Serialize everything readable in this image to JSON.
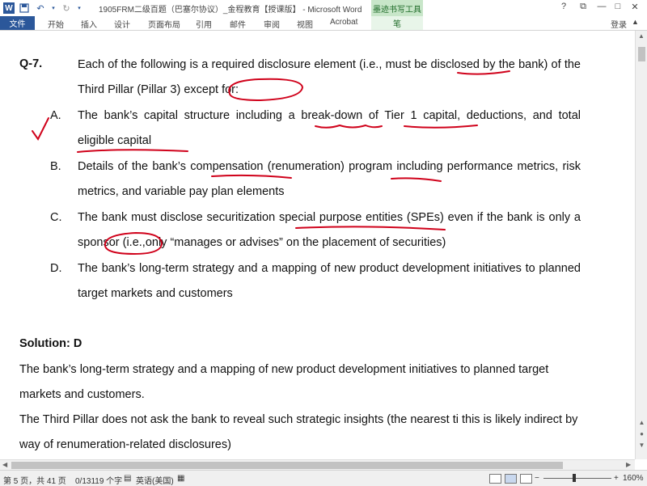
{
  "titlebar": {
    "title": "1905FRM二级百题（巴塞尔协议）_金程教育【授课版】 - Microsoft Word",
    "contextual_group": "墨迹书写工具",
    "help": "?",
    "restore": "⧉",
    "minimize": "—",
    "maximize": "□",
    "close": "✕"
  },
  "ribbon": {
    "file": "文件",
    "tabs": [
      "开始",
      "插入",
      "设计",
      "页面布局",
      "引用",
      "邮件",
      "审阅",
      "视图",
      "Acrobat"
    ],
    "contextual_tab": "笔",
    "login": "登录"
  },
  "document": {
    "question": {
      "label": "Q-7.",
      "stem": "Each of the following is a required disclosure element (i.e., must be disclosed by the bank) of the Third Pillar (Pillar 3) except for:"
    },
    "options": [
      {
        "letter": "A.",
        "text": "The bank’s capital structure including a break-down of Tier 1 capital, deductions, and total eligible capital"
      },
      {
        "letter": "B.",
        "text": "Details of the bank’s compensation (renumeration) program including performance metrics, risk metrics, and variable pay plan elements"
      },
      {
        "letter": "C.",
        "text": "The bank must disclose securitization special purpose entities (SPEs) even if the bank is only a sponsor (i.e.,only “manages or advises” on the placement of securities)"
      },
      {
        "letter": "D.",
        "text": "The bank’s long-term strategy and a mapping of new product development initiatives to planned target markets and customers"
      }
    ],
    "solution_heading": "Solution: D",
    "solution_lines": [
      "The bank’s long-term strategy and a mapping of new product development initiatives to planned target markets and customers.",
      "The Third Pillar does not ask the bank to reveal such strategic insights (the nearest ti this is likely indirect by way of renumeration-related disclosures)"
    ]
  },
  "statusbar": {
    "page": "第 5 页，共 41 页",
    "words": "0/13119 个字",
    "language": "英语(美国)",
    "zoom": "160%",
    "zoom_out": "−",
    "zoom_in": "+"
  },
  "colors": {
    "brand": "#2b579a",
    "ink": "#d0021b",
    "contextual": "#c8e6c9"
  }
}
